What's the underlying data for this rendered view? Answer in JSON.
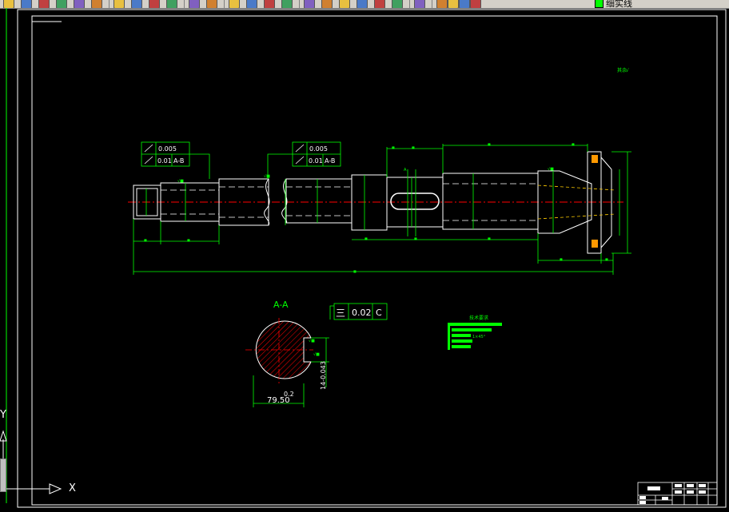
{
  "toolbar": {
    "icons": [
      "open-icon",
      "save-icon",
      "print-icon",
      "preview-icon",
      "publish-icon",
      "plot-icon",
      "cut-icon",
      "copy-icon",
      "paste-icon",
      "match-icon",
      "undo-icon",
      "redo-icon",
      "pan-icon",
      "zoom-realtime-icon",
      "zoom-window-icon",
      "zoom-previous-icon",
      "properties-icon",
      "design-center-icon",
      "tool-palette-icon",
      "sheet-set-icon",
      "markup-icon",
      "calculator-icon",
      "help-icon",
      "layer-manager-icon",
      "layer-on-icon",
      "layer-freeze-icon",
      "layer-lock-icon"
    ],
    "layer_name": "细实线",
    "layer_color": "#00ff00"
  },
  "drawing": {
    "tolerance_frame_1": {
      "value": "0.005",
      "value2": "0.01",
      "datum": "A-B"
    },
    "tolerance_frame_2": {
      "value": "0.005",
      "value2": "0.01",
      "datum": "A-B"
    },
    "section_title": "A-A",
    "section_tolerance": {
      "symbol": "三",
      "value": "0.02",
      "datum": "C"
    },
    "section_width": "79.50",
    "section_depth": "0.2",
    "section_keyway": "14-0.043",
    "tech_requirements_title": "技术要求",
    "tech_note_3": "1×45°",
    "corner_note": "其余"
  },
  "ucs": {
    "x_label": "X",
    "y_label": "Y"
  },
  "colors": {
    "background": "#000000",
    "border": "#ffffff",
    "geometry": "#ffffff",
    "dimension": "#00ff00",
    "centerline": "#ff0000",
    "hatch": "#ff0000"
  }
}
